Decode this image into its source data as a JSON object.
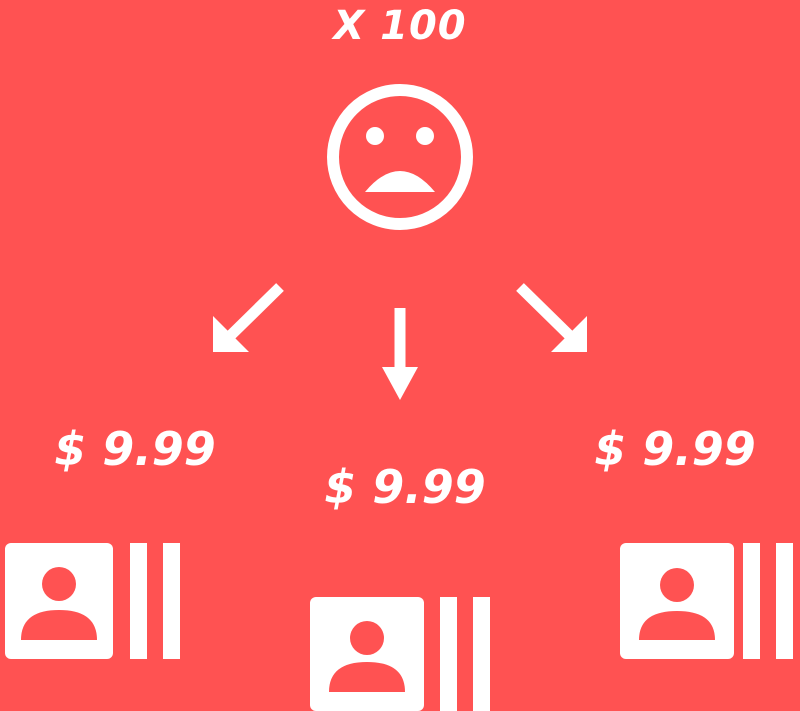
{
  "header": {
    "multiplier_label": "X 100"
  },
  "prices": {
    "left": "$ 9.99",
    "center": "$ 9.99",
    "right": "$ 9.99"
  },
  "icons": {
    "center": "sad-face-icon",
    "arrows": [
      "arrow-down-left-icon",
      "arrow-down-icon",
      "arrow-down-right-icon"
    ],
    "products": [
      "contact-card-barcode-icon",
      "contact-card-barcode-icon",
      "contact-card-barcode-icon"
    ]
  },
  "colors": {
    "background": "#ff5252",
    "foreground": "#ffffff"
  }
}
